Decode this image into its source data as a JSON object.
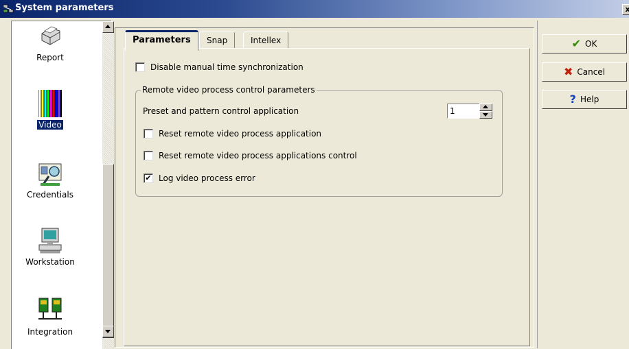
{
  "window": {
    "title": "System parameters",
    "close_label": "x"
  },
  "sidebar": {
    "items": [
      {
        "label": "Report",
        "icon": "printer-icon"
      },
      {
        "label": "Video",
        "icon": "video-bars-icon",
        "selected": true
      },
      {
        "label": "Credentials",
        "icon": "credentials-icon"
      },
      {
        "label": "Workstation",
        "icon": "computer-icon"
      },
      {
        "label": "Integration",
        "icon": "network-icon"
      }
    ]
  },
  "tabs": [
    {
      "label": "Parameters",
      "active": true
    },
    {
      "label": "Snap",
      "active": false
    },
    {
      "label": "Intellex",
      "active": false
    }
  ],
  "params": {
    "disable_time_sync": {
      "label": "Disable manual time synchronization",
      "checked": false
    },
    "group_title": "Remote video process control parameters",
    "preset_label": "Preset and pattern control application",
    "preset_value": "1",
    "reset_app": {
      "label": "Reset remote video process application",
      "checked": false
    },
    "reset_app_control": {
      "label": "Reset remote video process applications control",
      "checked": false
    },
    "log_error": {
      "label": "Log video process error",
      "checked": true
    }
  },
  "buttons": {
    "ok": "OK",
    "cancel": "Cancel",
    "help": "Help"
  },
  "colors": {
    "title_bar": "#0a246a",
    "selection": "#0a246a",
    "ok_check": "#2e8b00",
    "cancel_x": "#c0200a",
    "help_q": "#1040c0"
  }
}
